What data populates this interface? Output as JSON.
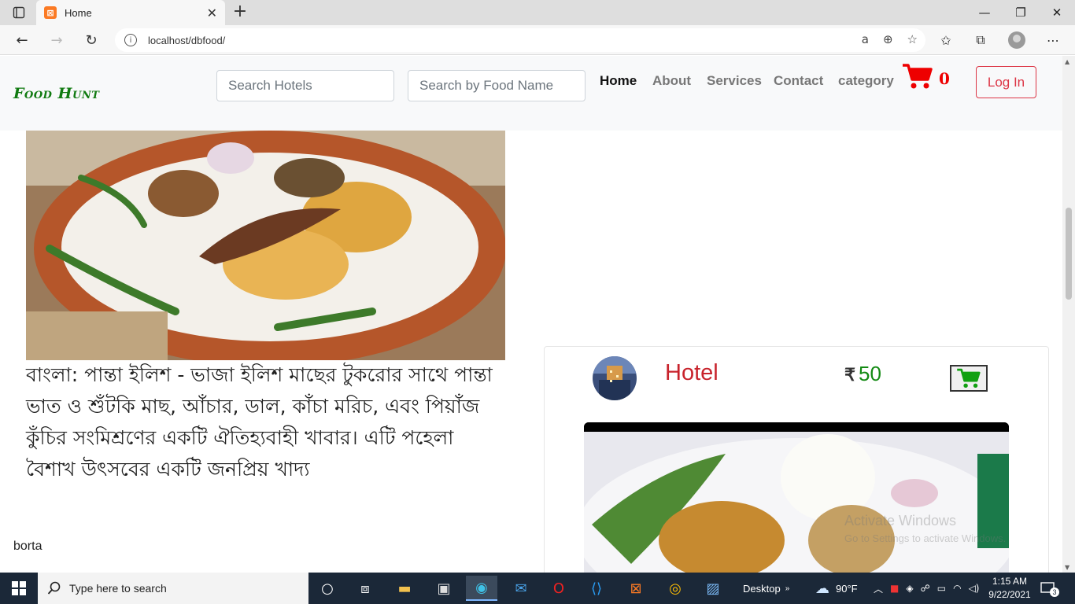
{
  "browser": {
    "tab_title": "Home",
    "url": "localhost/dbfood/"
  },
  "site": {
    "brand": "Food Hunt",
    "search_hotels_placeholder": "Search Hotels",
    "search_food_placeholder": "Search by Food Name",
    "menu": [
      "Home",
      "About",
      "Services",
      "Contact",
      "category"
    ],
    "cart_count": "0",
    "login_label": "Log In"
  },
  "food": {
    "description": "বাংলা: পান্তা ইলিশ - ভাজা ইলিশ মাছের টুকরোর সাথে পান্তা ভাত ও শুঁটকি মাছ, আঁচার, ডাল, কাঁচা মরিচ, এবং পিয়াঁজ কুঁচির সংমিশ্রণের একটি ঐতিহ্যবাহী খাবার। এটি পহেলা বৈশাখ উৎসবের একটি জনপ্রিয় খাদ্য",
    "name": "borta"
  },
  "card": {
    "hotel_name": "Hotel",
    "currency": "₹",
    "price": "50"
  },
  "watermark": {
    "line1": "Activate Windows",
    "line2": "Go to Settings to activate Windows."
  },
  "taskbar": {
    "search_placeholder": "Type here to search",
    "desktop_label": "Desktop",
    "weather": "90°F",
    "time": "1:15 AM",
    "date": "9/22/2021",
    "notification_count": "3"
  },
  "colors": {
    "brand": "#107a10",
    "cart": "#ee0000",
    "login": "#dc3545",
    "hotel_name": "#c8232c",
    "price": "#138a13"
  }
}
